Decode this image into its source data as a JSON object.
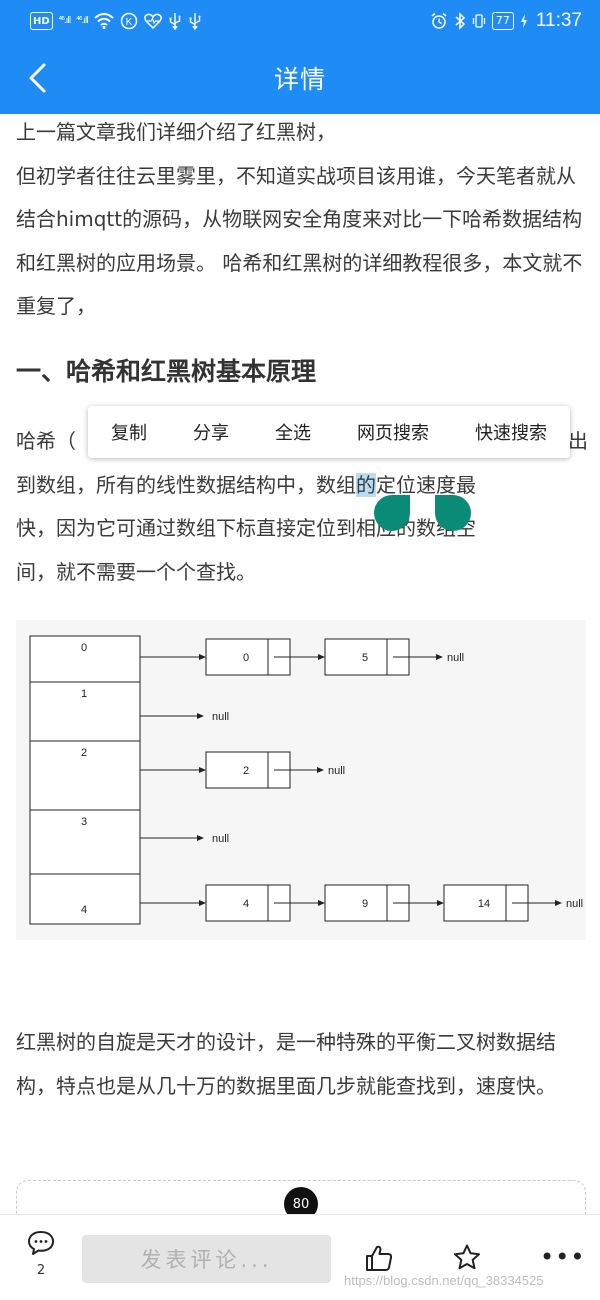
{
  "status_bar": {
    "hd": "HD",
    "signal1": "⁴⁶.ıll",
    "signal2": "⁴⁶.ıll",
    "k_badge": "K",
    "battery": "77",
    "time": "11:37"
  },
  "header": {
    "title": "详情"
  },
  "article": {
    "p1": "上一篇文章我们详细介绍了红黑树，\n但初学者往往云里雾里，不知道实战项目该用谁，今天笔者就从结合himqtt的源码，从物联网安全角度来对比一下哈希数据结构和红黑树的应用场景。 哈希和红黑树的详细教程很多，本文就不重复了，",
    "heading": "一、哈希和红黑树基本原理",
    "p2_line1_start": "哈希（",
    "p2_line1_end": "出",
    "p2_line2_a": "到数组，所有的线性数据结构中，数组",
    "p2_line2_sel": "的",
    "p2_line2_b": "定位速度最",
    "p2_line3": "快，因为它可通过数组下标直接定位到相应的数组空",
    "p2_line4": "间，就不需要一个个查找。",
    "p3": "红黑树的自旋是天才的设计，是一种特殊的平衡二叉树数据结构，特点也是从几十万的数据里面几步就能查找到，速度快。"
  },
  "context_menu": {
    "items": [
      "复制",
      "分享",
      "全选",
      "网页搜索",
      "快速搜索"
    ]
  },
  "diagram": {
    "buckets": [
      "0",
      "1",
      "2",
      "3",
      "4"
    ],
    "chains": [
      [
        "0",
        "5"
      ],
      [],
      [
        "2"
      ],
      [],
      [
        "4",
        "9",
        "14"
      ]
    ],
    "null_label": "null"
  },
  "badge": "80",
  "bottom_bar": {
    "comment_count": "2",
    "comment_placeholder": "发表评论...",
    "more": "•••",
    "watermark": "https://blog.csdn.net/qq_38334525"
  },
  "colors": {
    "accent": "#1f8bf5",
    "handle": "#0a8b78",
    "selection": "#b9dcf5"
  }
}
